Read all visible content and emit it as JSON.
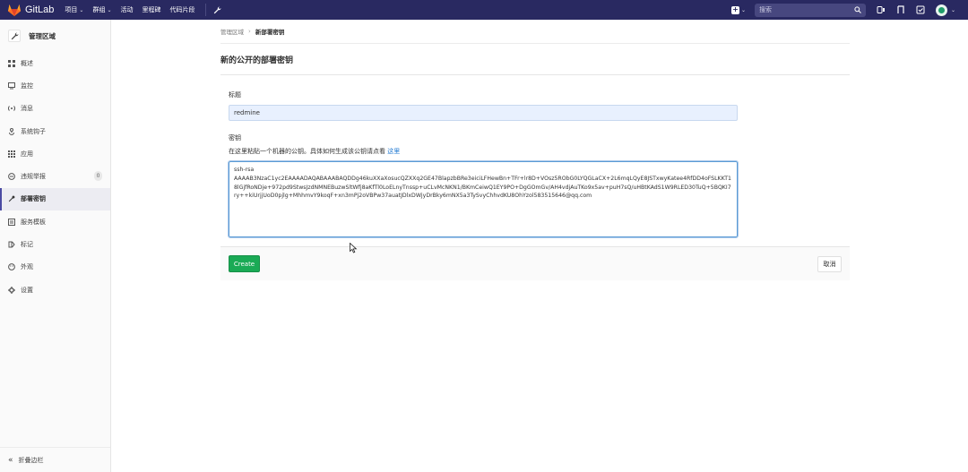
{
  "navbar": {
    "brand": "GitLab",
    "links": [
      {
        "label": "项目",
        "dropdown": true
      },
      {
        "label": "群组",
        "dropdown": true
      },
      {
        "label": "活动",
        "dropdown": false
      },
      {
        "label": "里程碑",
        "dropdown": false
      },
      {
        "label": "代码片段",
        "dropdown": false
      }
    ],
    "search_placeholder": "搜索",
    "brand_color": "#fc6d26",
    "bar_color": "#292961"
  },
  "sidebar": {
    "header": "管理区域",
    "items": [
      {
        "label": "概述",
        "icon": "overview-icon"
      },
      {
        "label": "监控",
        "icon": "monitor-icon"
      },
      {
        "label": "消息",
        "icon": "broadcast-icon"
      },
      {
        "label": "系统钩子",
        "icon": "hook-icon"
      },
      {
        "label": "应用",
        "icon": "apps-icon"
      },
      {
        "label": "违规举报",
        "icon": "report-icon",
        "badge": "0"
      },
      {
        "label": "部署密钥",
        "icon": "key-icon",
        "active": true
      },
      {
        "label": "服务模板",
        "icon": "template-icon"
      },
      {
        "label": "标记",
        "icon": "label-icon"
      },
      {
        "label": "外观",
        "icon": "appearance-icon"
      },
      {
        "label": "设置",
        "icon": "settings-icon"
      }
    ],
    "collapse": "折叠边栏"
  },
  "breadcrumb": {
    "parent": "管理区域",
    "current": "新部署密钥"
  },
  "page": {
    "title": "新的公开的部署密钥",
    "title_label": "标题",
    "title_value": "redmine",
    "key_label": "密钥",
    "help_text": "在这里粘贴一个机器的公钥。具体如何生成该公钥请点看",
    "help_link": "这里",
    "key_value": "ssh-rsa\nAAAAB3NzaC1yc2EAAAADAQABAAABAQDDg46kuXXaXosucQZXXq2GE47BlapzbBRe3eiciLFHewBn+TFr+lr8D+VOsz5RObG0LYQGLaCX+2L6mqLQyE8JSTxwyKatee4RfDD4oFSLKKT18lGjfRoNDje+972pd9StwsJzdNMNEBuzwSltWfj8aKfTl0LoELnyTnssp+uCLvMcNKN1/BKmCeiwQ1EY9PO+DgGOmGv/AH4vdjAuTKo9x5av+puH7sQ/uHBtKAdS1W9RLED30TuQ+5BQKI7ry++kiUrjjUoD0pjlg+MhhmvY9koqF+xn3mPj2oVBPw37auatJDlxDWjyDrBky6mNX5a3TySvyChhvdKU8OhYzol583515646@qq.com",
    "create_button": "Create",
    "cancel_button": "取消"
  }
}
